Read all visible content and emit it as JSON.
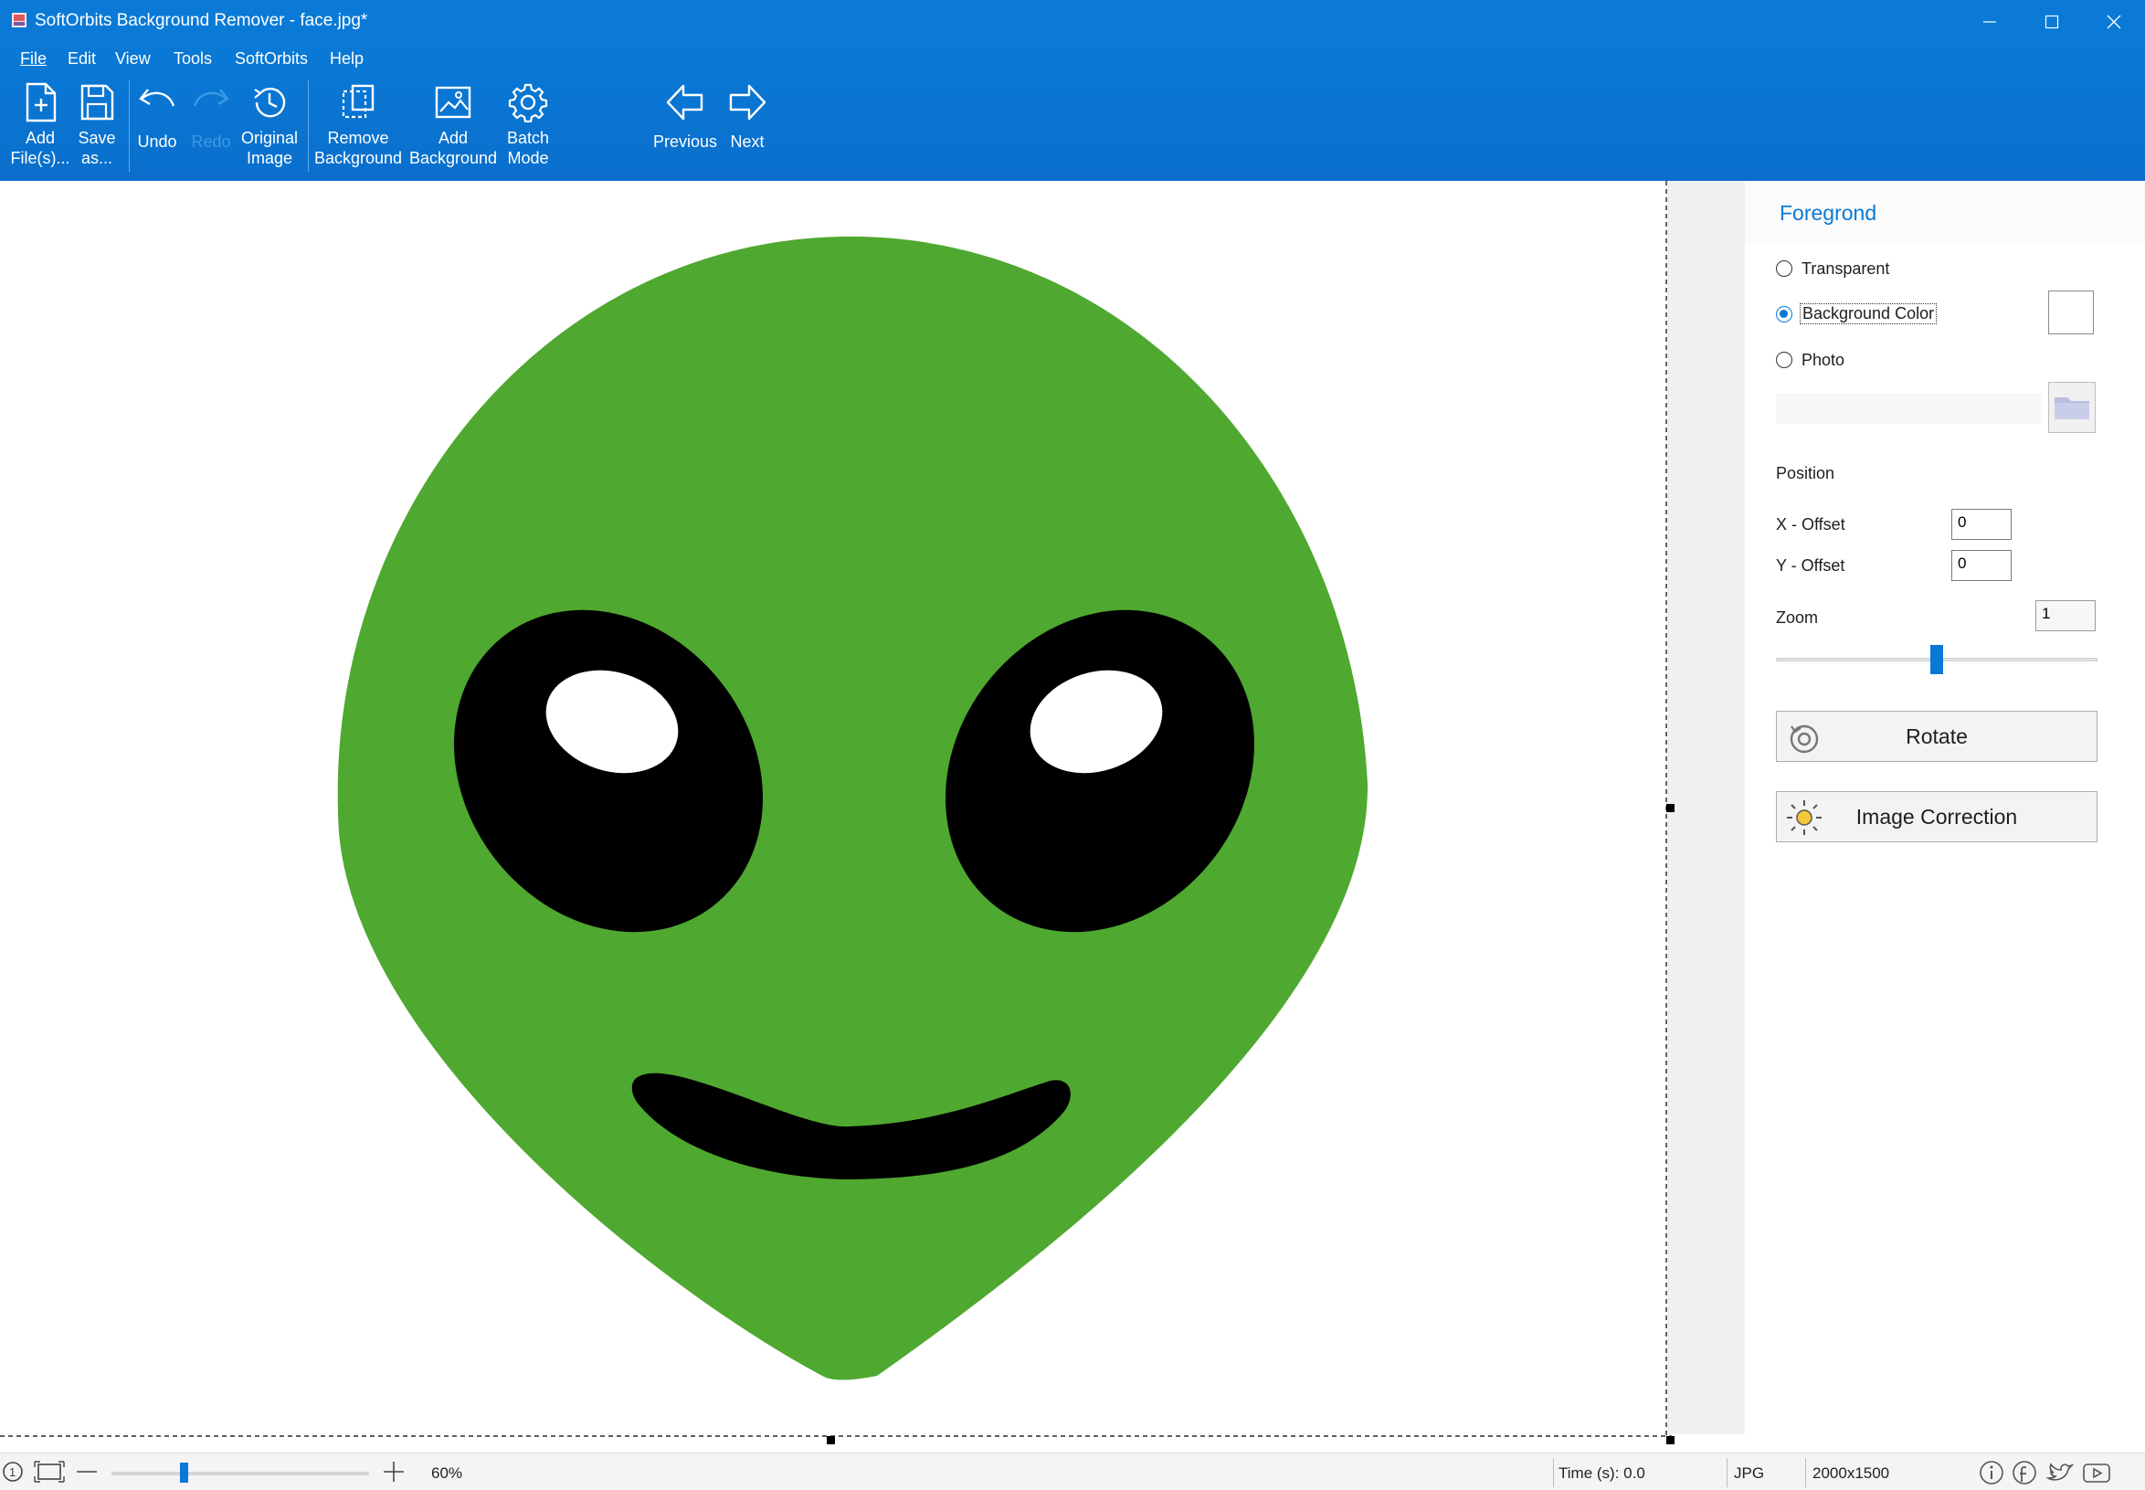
{
  "window": {
    "title": "SoftOrbits Background Remover - face.jpg*",
    "controls": [
      "minimize-icon",
      "maximize-icon",
      "close-icon"
    ]
  },
  "menu": {
    "file": "File",
    "edit": "Edit",
    "view": "View",
    "tools": "Tools",
    "softorbits": "SoftOrbits",
    "help": "Help"
  },
  "toolbar": {
    "add_files": [
      "Add",
      "File(s)..."
    ],
    "save_as": [
      "Save",
      "as..."
    ],
    "undo": "Undo",
    "redo": "Redo",
    "original_image": [
      "Original",
      "Image"
    ],
    "remove_background": [
      "Remove",
      "Background"
    ],
    "add_background": [
      "Add",
      "Background"
    ],
    "batch_mode": [
      "Batch",
      "Mode"
    ],
    "previous": "Previous",
    "next": "Next"
  },
  "panel": {
    "header": "Foregrond",
    "options": {
      "transparent": "Transparent",
      "background_color": "Background Color",
      "photo": "Photo"
    },
    "selected_option": "background_color",
    "position_label": "Position",
    "x_offset_label": "X - Offset",
    "x_offset_value": "0",
    "y_offset_label": "Y - Offset",
    "y_offset_value": "0",
    "zoom_label": "Zoom",
    "zoom_value": "1",
    "zoom_slider_fraction": 0.5,
    "rotate_label": "Rotate",
    "image_correction_label": "Image Correction"
  },
  "status": {
    "zoom_percent": "60%",
    "zoom_slider_fraction": 0.28,
    "time": "Time (s): 0.0",
    "format": "JPG",
    "dimensions": "2000x1500"
  },
  "colors": {
    "accent": "#0a78d5",
    "alien_green": "#4fa830",
    "eye_black": "#000000",
    "eye_highlight": "#ffffff"
  }
}
